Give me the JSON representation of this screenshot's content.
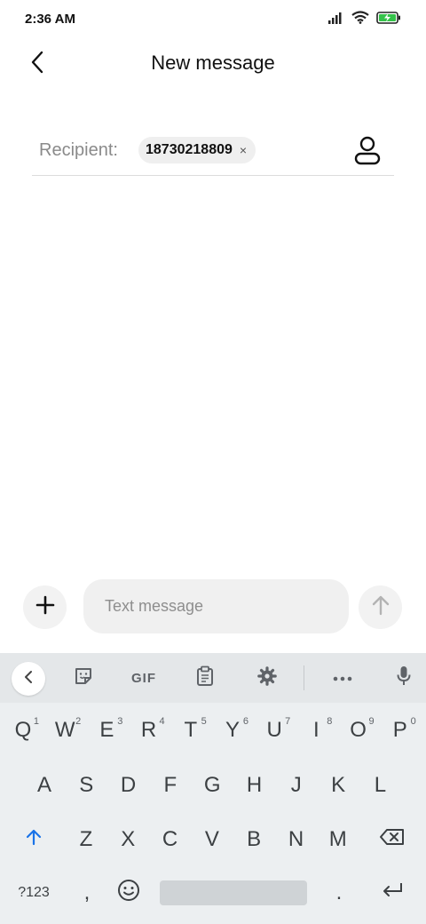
{
  "status_bar": {
    "time": "2:36 AM"
  },
  "header": {
    "title": "New message"
  },
  "recipient": {
    "label": "Recipient:",
    "chip_number": "18730218809",
    "chip_remove": "×"
  },
  "composer": {
    "placeholder": "Text message"
  },
  "keyboard": {
    "toolbar": {
      "gif_label": "GIF"
    },
    "row1": [
      {
        "label": "Q",
        "hint": "1"
      },
      {
        "label": "W",
        "hint": "2"
      },
      {
        "label": "E",
        "hint": "3"
      },
      {
        "label": "R",
        "hint": "4"
      },
      {
        "label": "T",
        "hint": "5"
      },
      {
        "label": "Y",
        "hint": "6"
      },
      {
        "label": "U",
        "hint": "7"
      },
      {
        "label": "I",
        "hint": "8"
      },
      {
        "label": "O",
        "hint": "9"
      },
      {
        "label": "P",
        "hint": "0"
      }
    ],
    "row2": [
      "A",
      "S",
      "D",
      "F",
      "G",
      "H",
      "J",
      "K",
      "L"
    ],
    "row3": [
      "Z",
      "X",
      "C",
      "V",
      "B",
      "N",
      "M"
    ],
    "row4": {
      "symbols": "?123",
      "comma": ",",
      "period": "."
    }
  }
}
